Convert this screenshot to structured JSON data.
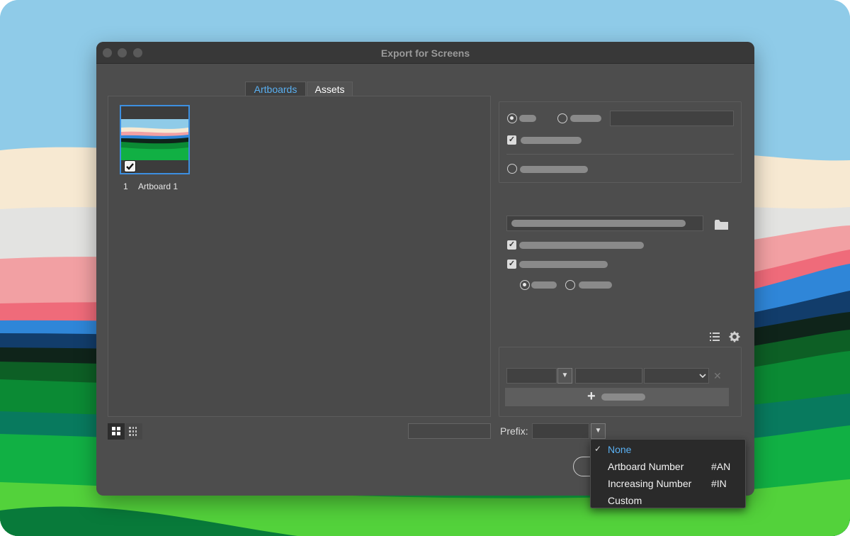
{
  "window": {
    "title": "Export for Screens"
  },
  "tabs": [
    {
      "label": "Artboards",
      "active": true
    },
    {
      "label": "Assets",
      "active": false
    }
  ],
  "artboards": [
    {
      "number": "1",
      "name": "Artboard 1",
      "checked": true,
      "selected": true
    }
  ],
  "footer": {
    "prefix_label": "Prefix:"
  },
  "prefix_menu": {
    "selected": "None",
    "items": [
      {
        "label": "None",
        "shortcut": "",
        "checked": true
      },
      {
        "label": "Artboard Number",
        "shortcut": "#AN",
        "checked": false
      },
      {
        "label": "Increasing Number",
        "shortcut": "#IN",
        "checked": false
      },
      {
        "label": "Custom",
        "shortcut": "",
        "checked": false
      }
    ]
  },
  "icons": {
    "view_grid": "grid-view-icon",
    "view_list": "list-view-icon",
    "folder": "folder-icon",
    "list": "list-icon",
    "settings": "gear-icon",
    "remove": "close-icon",
    "add": "plus-icon",
    "dropdown": "chevron-down-icon",
    "check": "checkmark-icon"
  },
  "colors": {
    "accent": "#5ab0f2",
    "selection_border": "#3d8fe0",
    "window_bg": "#4d4d4d",
    "titlebar_bg": "#383838",
    "menu_bg": "#2a2a2a"
  }
}
